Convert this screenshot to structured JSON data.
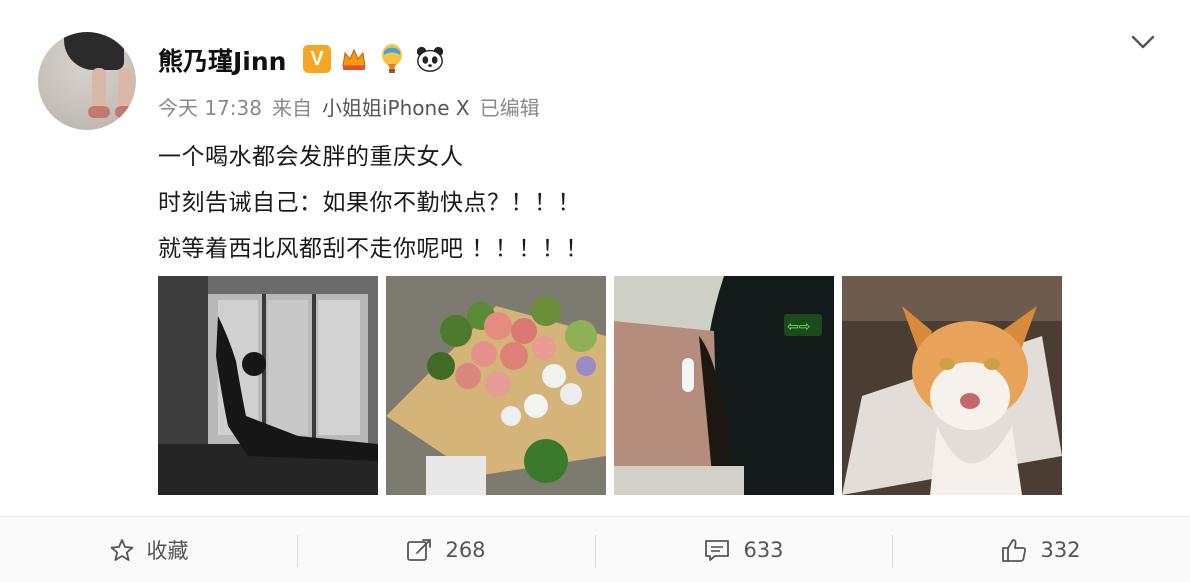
{
  "post": {
    "username": "熊乃瑾Jinn",
    "badges": [
      "verified-v-badge",
      "crown-badge",
      "hot-air-balloon-badge",
      "panda-badge"
    ],
    "verified_letter": "V",
    "meta": {
      "time": "今天 17:38",
      "from_label": "来自",
      "source": "小姐姐iPhone X",
      "edited": "已编辑"
    },
    "lines": [
      "一个喝水都会发胖的重庆女人",
      "时刻告诫自己：如果你不勤快点？！！！",
      "就等着西北风都刮不走你呢吧 ！！！！！"
    ],
    "photos": [
      "stretching-silhouette-photo",
      "flower-bouquet-photo",
      "selfie-with-earbud-photo",
      "orange-cat-photo"
    ]
  },
  "actions": {
    "favorite_label": "收藏",
    "repost_count": "268",
    "comment_count": "633",
    "like_count": "332"
  },
  "colors": {
    "verified": "#f5a623",
    "meta_text": "#8a8a8a",
    "footer_bg": "#fafafa"
  }
}
